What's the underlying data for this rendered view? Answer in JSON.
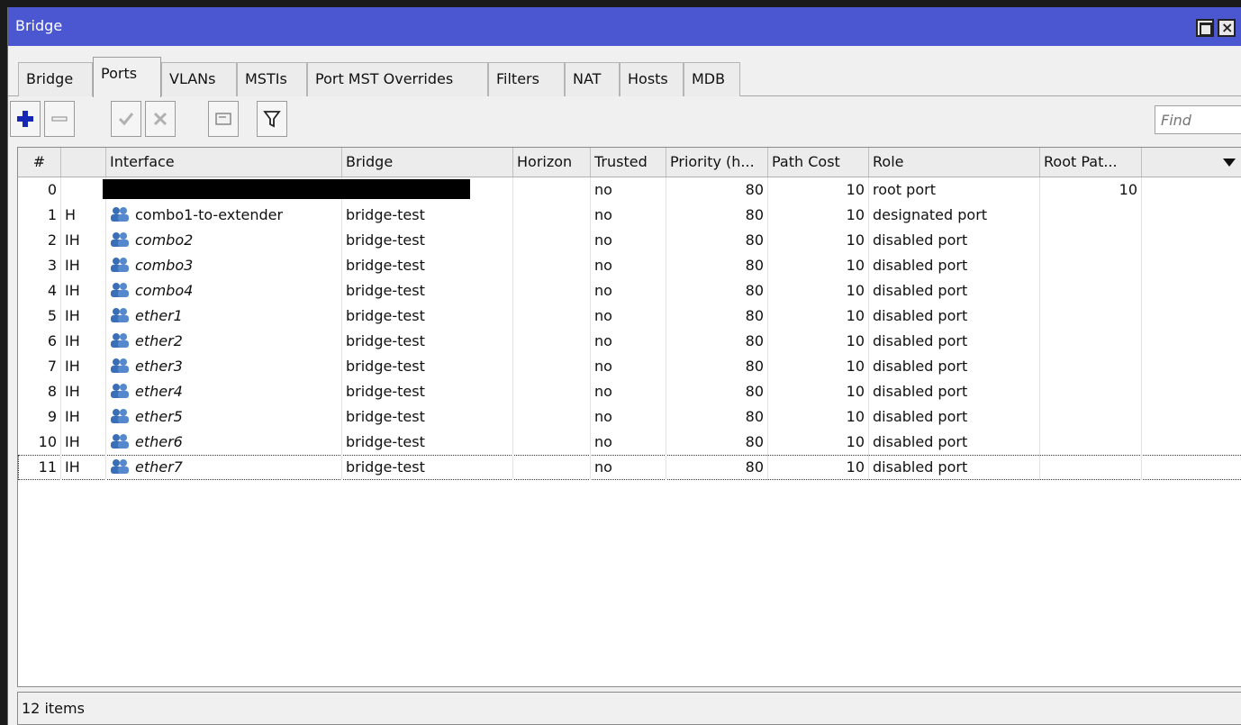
{
  "window": {
    "title": "Bridge",
    "close_glyph": "×"
  },
  "tabs": [
    {
      "label": "Bridge",
      "active": false
    },
    {
      "label": "Ports",
      "active": true
    },
    {
      "label": "VLANs",
      "active": false
    },
    {
      "label": "MSTIs",
      "active": false
    },
    {
      "label": "Port MST Overrides",
      "active": false
    },
    {
      "label": "Filters",
      "active": false
    },
    {
      "label": "NAT",
      "active": false
    },
    {
      "label": "Hosts",
      "active": false
    },
    {
      "label": "MDB",
      "active": false
    }
  ],
  "toolbar": {
    "icons": [
      "add-icon",
      "remove-icon",
      "enable-icon",
      "disable-icon",
      "comment-icon",
      "filter-icon"
    ],
    "find_placeholder": "Find"
  },
  "table": {
    "columns": [
      "#",
      "",
      "Interface",
      "Bridge",
      "Horizon",
      "Trusted",
      "Priority (h...",
      "Path Cost",
      "Role",
      "Root Pat...",
      ""
    ],
    "rows": [
      {
        "num": "0",
        "flags": "",
        "interface": "",
        "bridge": "",
        "horizon": "",
        "trusted": "no",
        "priority": "80",
        "path_cost": "10",
        "role": "root port",
        "root_path": "10",
        "redacted": true,
        "disabled": false
      },
      {
        "num": "1",
        "flags": "H",
        "interface": "combo1-to-extender",
        "bridge": "bridge-test",
        "horizon": "",
        "trusted": "no",
        "priority": "80",
        "path_cost": "10",
        "role": "designated port",
        "root_path": "",
        "redacted": false,
        "disabled": false
      },
      {
        "num": "2",
        "flags": "IH",
        "interface": "combo2",
        "bridge": "bridge-test",
        "horizon": "",
        "trusted": "no",
        "priority": "80",
        "path_cost": "10",
        "role": "disabled port",
        "root_path": "",
        "redacted": false,
        "disabled": true
      },
      {
        "num": "3",
        "flags": "IH",
        "interface": "combo3",
        "bridge": "bridge-test",
        "horizon": "",
        "trusted": "no",
        "priority": "80",
        "path_cost": "10",
        "role": "disabled port",
        "root_path": "",
        "redacted": false,
        "disabled": true
      },
      {
        "num": "4",
        "flags": "IH",
        "interface": "combo4",
        "bridge": "bridge-test",
        "horizon": "",
        "trusted": "no",
        "priority": "80",
        "path_cost": "10",
        "role": "disabled port",
        "root_path": "",
        "redacted": false,
        "disabled": true
      },
      {
        "num": "5",
        "flags": "IH",
        "interface": "ether1",
        "bridge": "bridge-test",
        "horizon": "",
        "trusted": "no",
        "priority": "80",
        "path_cost": "10",
        "role": "disabled port",
        "root_path": "",
        "redacted": false,
        "disabled": true
      },
      {
        "num": "6",
        "flags": "IH",
        "interface": "ether2",
        "bridge": "bridge-test",
        "horizon": "",
        "trusted": "no",
        "priority": "80",
        "path_cost": "10",
        "role": "disabled port",
        "root_path": "",
        "redacted": false,
        "disabled": true
      },
      {
        "num": "7",
        "flags": "IH",
        "interface": "ether3",
        "bridge": "bridge-test",
        "horizon": "",
        "trusted": "no",
        "priority": "80",
        "path_cost": "10",
        "role": "disabled port",
        "root_path": "",
        "redacted": false,
        "disabled": true
      },
      {
        "num": "8",
        "flags": "IH",
        "interface": "ether4",
        "bridge": "bridge-test",
        "horizon": "",
        "trusted": "no",
        "priority": "80",
        "path_cost": "10",
        "role": "disabled port",
        "root_path": "",
        "redacted": false,
        "disabled": true
      },
      {
        "num": "9",
        "flags": "IH",
        "interface": "ether5",
        "bridge": "bridge-test",
        "horizon": "",
        "trusted": "no",
        "priority": "80",
        "path_cost": "10",
        "role": "disabled port",
        "root_path": "",
        "redacted": false,
        "disabled": true
      },
      {
        "num": "10",
        "flags": "IH",
        "interface": "ether6",
        "bridge": "bridge-test",
        "horizon": "",
        "trusted": "no",
        "priority": "80",
        "path_cost": "10",
        "role": "disabled port",
        "root_path": "",
        "redacted": false,
        "disabled": true
      },
      {
        "num": "11",
        "flags": "IH",
        "interface": "ether7",
        "bridge": "bridge-test",
        "horizon": "",
        "trusted": "no",
        "priority": "80",
        "path_cost": "10",
        "role": "disabled port",
        "root_path": "",
        "redacted": false,
        "disabled": true
      }
    ]
  },
  "status": {
    "text": "12 items"
  },
  "colors": {
    "titlebar": "#4a57d0",
    "add_icon": "#1428b4",
    "interface_icon": "#3a6fb8"
  }
}
